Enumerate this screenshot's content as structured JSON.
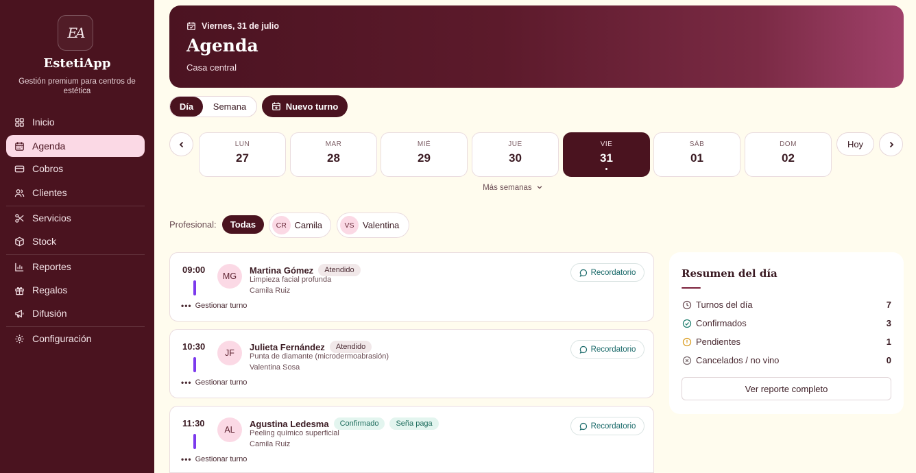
{
  "sidebar": {
    "logo_text": "EA",
    "brand": "EstetiApp",
    "tagline": "Gestión premium para centros de estética",
    "items": [
      {
        "label": "Inicio",
        "icon": "grid-icon"
      },
      {
        "label": "Agenda",
        "icon": "calendar-icon",
        "active": true
      },
      {
        "label": "Cobros",
        "icon": "credit-card-icon"
      },
      {
        "label": "Clientes",
        "icon": "users-icon"
      },
      {
        "label": "Servicios",
        "icon": "scissors-icon"
      },
      {
        "label": "Stock",
        "icon": "box-icon"
      },
      {
        "label": "Reportes",
        "icon": "bar-chart-icon"
      },
      {
        "label": "Regalos",
        "icon": "gift-icon"
      },
      {
        "label": "Difusión",
        "icon": "megaphone-icon"
      },
      {
        "label": "Configuración",
        "icon": "gear-icon"
      }
    ]
  },
  "header": {
    "date": "Viernes, 31 de julio",
    "title": "Agenda",
    "location": "Casa central",
    "accent": "#4a131f",
    "gradient_end": "#a0416a"
  },
  "view_toggle": {
    "day": "Día",
    "week": "Semana"
  },
  "new_appointment": "Nuevo turno",
  "week": {
    "days": [
      {
        "name": "LUN",
        "num": "27"
      },
      {
        "name": "MAR",
        "num": "28"
      },
      {
        "name": "MIÉ",
        "num": "29"
      },
      {
        "name": "JUE",
        "num": "30"
      },
      {
        "name": "VIE",
        "num": "31",
        "selected": true
      },
      {
        "name": "SÁB",
        "num": "01"
      },
      {
        "name": "DOM",
        "num": "02"
      }
    ],
    "today": "Hoy",
    "more": "Más semanas"
  },
  "filter": {
    "label": "Profesional:",
    "all": "Todas",
    "pros": [
      {
        "initials": "CR",
        "name": "Camila"
      },
      {
        "initials": "VS",
        "name": "Valentina"
      }
    ]
  },
  "appointments": [
    {
      "time": "09:00",
      "initials": "MG",
      "client": "Martina Gómez",
      "badges": [
        {
          "text": "Atendido",
          "kind": "grey"
        }
      ],
      "service": "Limpieza facial profunda",
      "pro": "Camila Ruiz",
      "manage": "Gestionar turno",
      "reminder": "Recordatorio"
    },
    {
      "time": "10:30",
      "initials": "JF",
      "client": "Julieta Fernández",
      "badges": [
        {
          "text": "Atendido",
          "kind": "grey"
        }
      ],
      "service": "Punta de diamante (microdermoabrasión)",
      "pro": "Valentina Sosa",
      "manage": "Gestionar turno",
      "reminder": "Recordatorio"
    },
    {
      "time": "11:30",
      "initials": "AL",
      "client": "Agustina Ledesma",
      "badges": [
        {
          "text": "Confirmado",
          "kind": "teal"
        },
        {
          "text": "Seña paga",
          "kind": "teal"
        }
      ],
      "service": "Peeling químico superficial",
      "pro": "Camila Ruiz",
      "manage": "Gestionar turno",
      "reminder": "Recordatorio"
    }
  ],
  "summary": {
    "title": "Resumen del día",
    "rows": [
      {
        "label": "Turnos del día",
        "value": "7",
        "icon": "clock-icon",
        "color": "#6a4c53"
      },
      {
        "label": "Confirmados",
        "value": "3",
        "icon": "check-circle-icon",
        "color": "#1a7a6a"
      },
      {
        "label": "Pendientes",
        "value": "1",
        "icon": "alert-circle-icon",
        "color": "#d99a1a"
      },
      {
        "label": "Cancelados / no vino",
        "value": "0",
        "icon": "x-circle-icon",
        "color": "#7a6a6e"
      }
    ],
    "button": "Ver reporte completo"
  }
}
